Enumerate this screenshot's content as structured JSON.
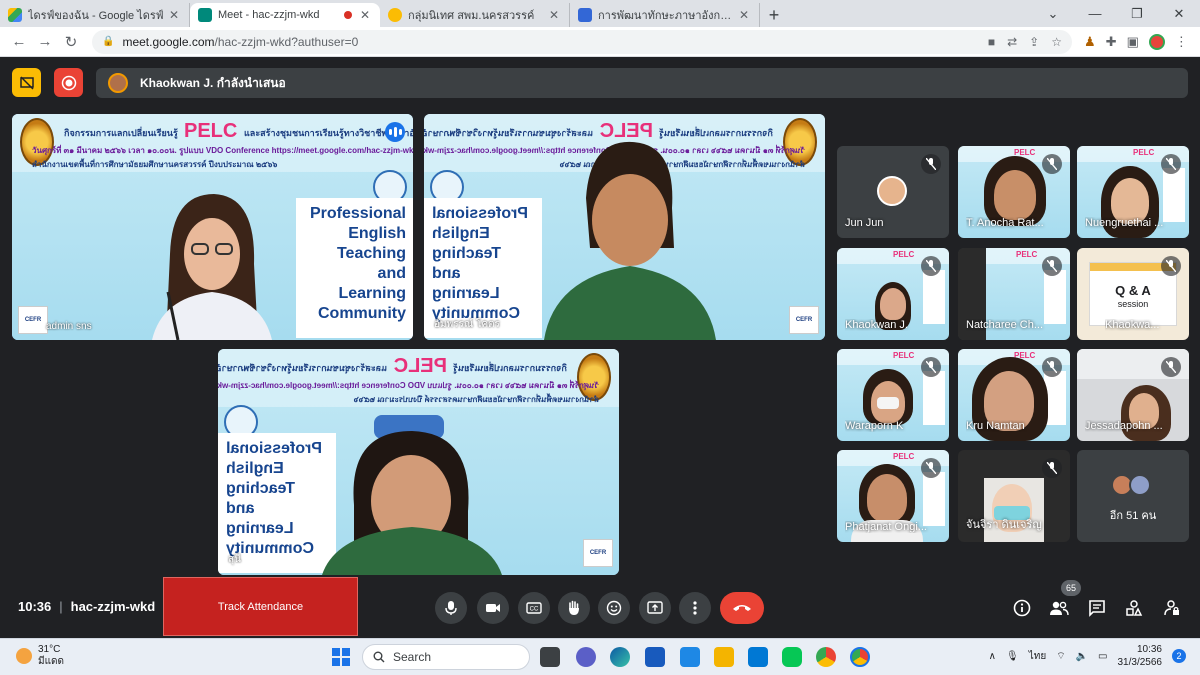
{
  "browser": {
    "tabs": [
      {
        "title": "ไดรฟ์ของฉัน - Google ไดรฟ์",
        "favicon_color": "#34a853"
      },
      {
        "title": "Meet - hac-zzjm-wkd",
        "favicon_color": "#00897b",
        "recording": true
      },
      {
        "title": "กลุ่มนิเทศ สพม.นครสวรรค์",
        "favicon_color": "#fbbc04"
      },
      {
        "title": "การพัฒนาทักษะภาษาอังกฤษ English",
        "favicon_color": "#3367d6"
      }
    ],
    "new_tab": "+",
    "url_host": "meet.google.com",
    "url_path": "/hac-zzjm-wkd?authuser=0"
  },
  "meet": {
    "presenting_banner": "Khaokwan J. กำลังนำเสนอ",
    "meeting_time": "10:36",
    "meeting_code": "hac-zzjm-wkd",
    "track_attendance": "Track Attendance",
    "participants_count": "65",
    "more_participants": "อีก 51 คน"
  },
  "slide": {
    "title_prefix": "กิจกรรมการแลกเปลี่ยนเรียนรู้",
    "pelc": "PELC",
    "title_suffix": "และสร้างชุมชนการเรียนรู้ทางวิชาชีพภาษาอังกฤษ",
    "date_line": "วันศุกร์ที่ ๓๑ มีนาคม ๒๕๖๖ เวลา ๑๐.๐๐น. รูปแบบ VDO Conference https://meet.google.com/hac-zzjm-wkd",
    "office_line": "สำนักงานเขตพื้นที่การศึกษามัธยมศึกษานครสวรรค์  ปีงบประมาณ ๒๕๖๖",
    "box_lines": [
      "Professional",
      "English",
      "Teaching",
      "and",
      "Learning",
      "Community"
    ],
    "cefr": "CEFR"
  },
  "main_tiles": [
    {
      "name": "admin sns"
    },
    {
      "name": "อัมพรรณ์ โคตร"
    },
    {
      "name": "สุนี"
    }
  ],
  "thumbnails": [
    {
      "name": "Jun Jun"
    },
    {
      "name": "T. Anocha Rat..."
    },
    {
      "name": "Nuengruethai ..."
    },
    {
      "name": "Khaokwan J."
    },
    {
      "name": "Natcharee Ch..."
    },
    {
      "name": "Khaokwa..."
    },
    {
      "name": "Waraporn K"
    },
    {
      "name": "Kru Namtan"
    },
    {
      "name": "Jessadapohn ..."
    },
    {
      "name": "Phatjanat Ongi..."
    },
    {
      "name": "จันจิรา ดินเจริญ"
    }
  ],
  "qa_slide": {
    "title": "Q & A",
    "subtitle": "session"
  },
  "taskbar": {
    "temperature": "31°C",
    "weather_desc": "มีแดด",
    "search_placeholder": "Search",
    "language": "ไทย",
    "time": "10:36",
    "date": "31/3/2566",
    "notification_count": "2"
  }
}
